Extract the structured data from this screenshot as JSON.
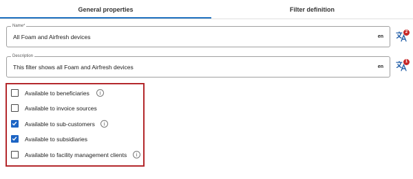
{
  "tabs": [
    {
      "label": "General properties",
      "active": true
    },
    {
      "label": "Filter definition",
      "active": false
    }
  ],
  "name_field": {
    "label": "Name*",
    "value": "All Foam and Airfresh devices",
    "lang": "en",
    "translations_badge": "2"
  },
  "description_field": {
    "label": "Description",
    "value": "This filter shows all Foam and Airfresh devices",
    "lang": "en",
    "translations_badge": "1"
  },
  "availability": [
    {
      "label": "Available to beneficiaries",
      "checked": false,
      "has_info": true
    },
    {
      "label": "Available to invoice sources",
      "checked": false,
      "has_info": false
    },
    {
      "label": "Available to sub-customers",
      "checked": true,
      "has_info": true
    },
    {
      "label": "Available to subsidiaries",
      "checked": true,
      "has_info": false
    },
    {
      "label": "Available to facility management clients",
      "checked": false,
      "has_info": true
    }
  ],
  "colors": {
    "accent": "#1c6fbf",
    "checkbox_checked": "#1c64c4",
    "highlight_border": "#b3262a",
    "badge": "#c62828"
  },
  "icons": {
    "translate": "translate-icon",
    "info": "info-icon",
    "check": "check-icon"
  }
}
